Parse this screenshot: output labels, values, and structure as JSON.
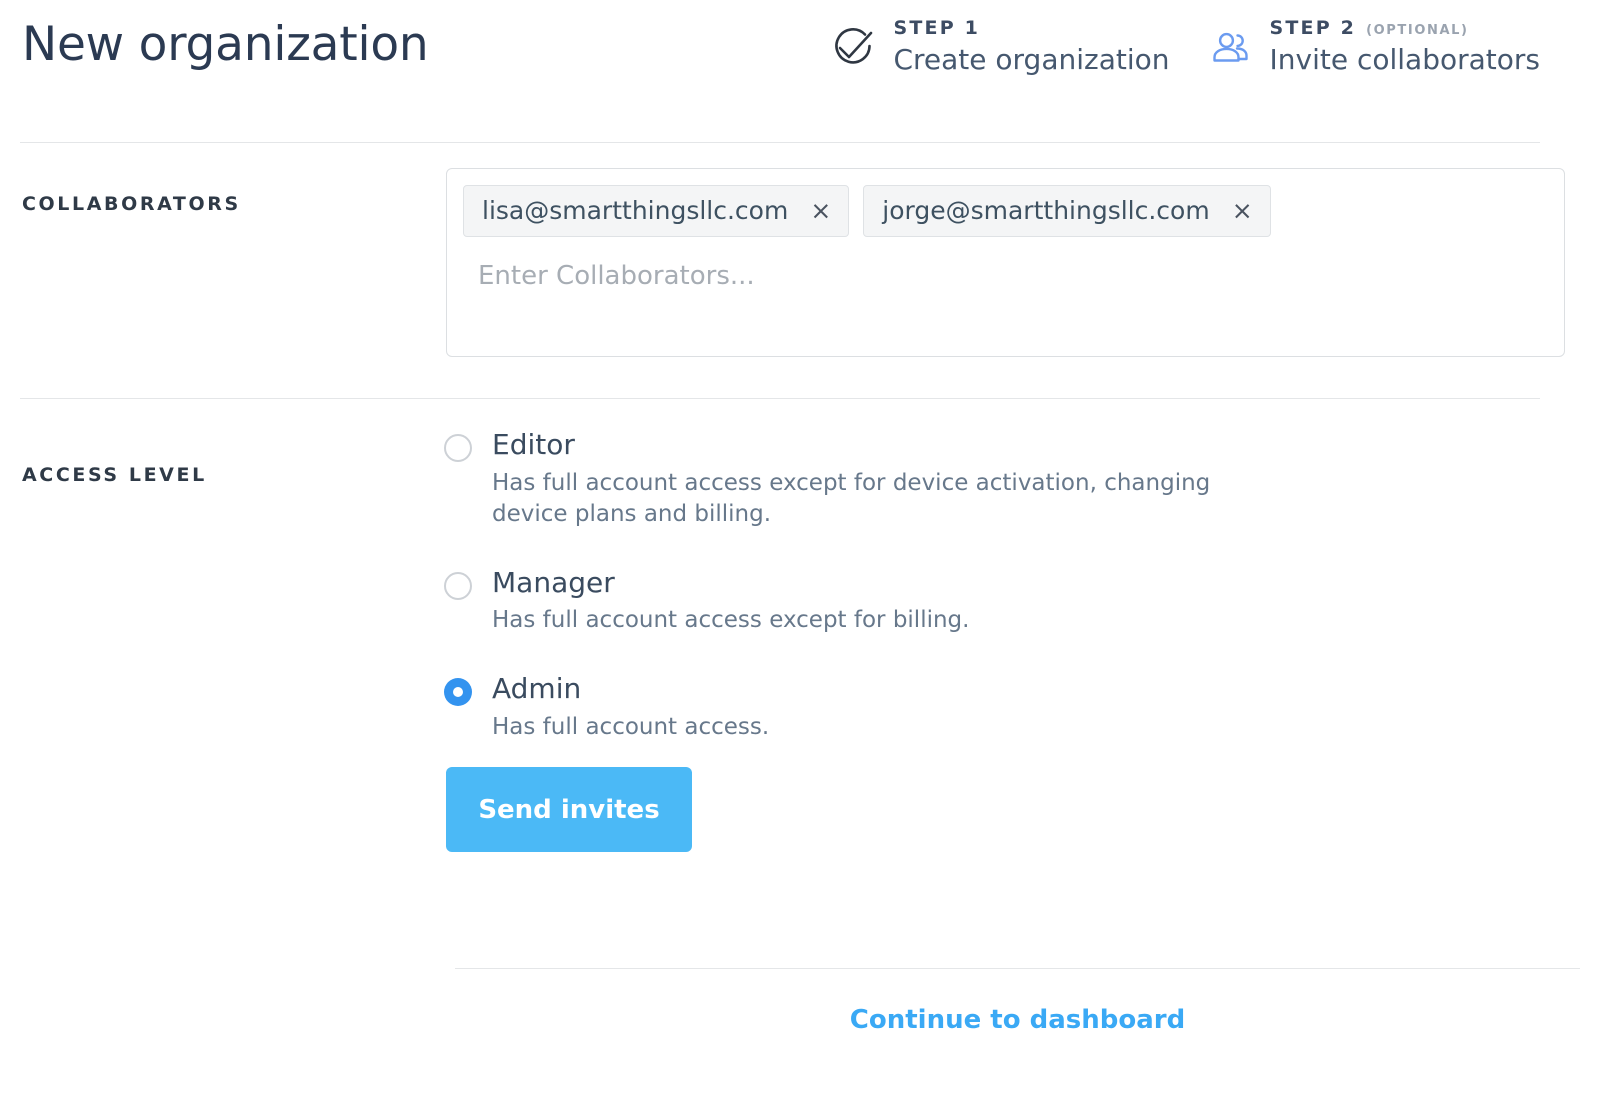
{
  "header": {
    "title": "New organization",
    "steps": [
      {
        "kicker": "STEP 1",
        "optional": "",
        "name": "Create organization",
        "icon": "check-circle-icon",
        "state": "complete"
      },
      {
        "kicker": "STEP 2",
        "optional": "(OPTIONAL)",
        "name": "Invite collaborators",
        "icon": "people-icon",
        "state": "current"
      }
    ]
  },
  "collaborators": {
    "label": "COLLABORATORS",
    "chips": [
      {
        "email": "lisa@smartthingsllc.com",
        "close": "×"
      },
      {
        "email": "jorge@smartthingsllc.com",
        "close": "×"
      }
    ],
    "input": {
      "value": "",
      "placeholder": "Enter Collaborators..."
    }
  },
  "access_level": {
    "label": "ACCESS LEVEL",
    "selected": "Admin",
    "options": [
      {
        "name": "Editor",
        "description": "Has full account access except for device activation, changing device plans and billing.",
        "selected": false
      },
      {
        "name": "Manager",
        "description": "Has full account access except for billing.",
        "selected": false
      },
      {
        "name": "Admin",
        "description": "Has full account access.",
        "selected": true
      }
    ]
  },
  "actions": {
    "send_invites": "Send invites",
    "continue": "Continue to dashboard"
  },
  "colors": {
    "accent_blue": "#4bb9f6",
    "link_blue": "#3aa9f5",
    "radio_blue": "#3393ef",
    "title_navy": "#2b3a52",
    "divider": "#e4e6e8",
    "chip_bg": "#f4f5f6"
  }
}
